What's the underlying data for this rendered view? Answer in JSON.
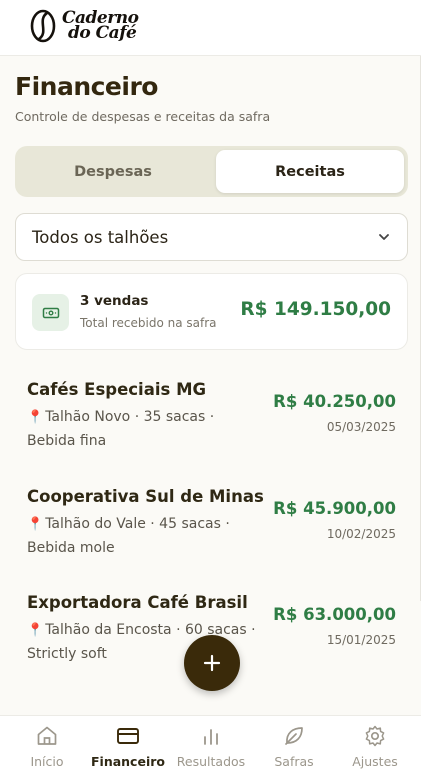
{
  "header": {
    "logo_line1": "Caderno",
    "logo_line2": "do Café"
  },
  "page": {
    "title": "Financeiro",
    "subtitle": "Controle de despesas e receitas da safra"
  },
  "tabs": [
    {
      "label": "Despesas",
      "active": false
    },
    {
      "label": "Receitas",
      "active": true
    }
  ],
  "filter": {
    "selected": "Todos os talhões"
  },
  "summary": {
    "count": "3 vendas",
    "label": "Total recebido na safra",
    "total": "R$ 149.150,00",
    "icon": "money-icon"
  },
  "sales": [
    {
      "buyer": "Cafés Especiais MG",
      "plot": "Talhão Novo · 35 sacas ·",
      "quality": "Bebida fina",
      "amount": "R$ 40.250,00",
      "date": "05/03/2025"
    },
    {
      "buyer": "Cooperativa Sul de Minas",
      "plot": "Talhão do Vale · 45 sacas ·",
      "quality": "Bebida mole",
      "amount": "R$ 45.900,00",
      "date": "10/02/2025"
    },
    {
      "buyer": "Exportadora Café Brasil",
      "plot": "Talhão da Encosta · 60 sacas ·",
      "quality": "Strictly soft",
      "amount": "R$ 63.000,00",
      "date": "15/01/2025"
    }
  ],
  "fab_icon": "plus-icon",
  "nav": [
    {
      "label": "Início",
      "icon": "home-icon",
      "active": false
    },
    {
      "label": "Financeiro",
      "icon": "wallet-icon",
      "active": true
    },
    {
      "label": "Resultados",
      "icon": "bar-chart-icon",
      "active": false
    },
    {
      "label": "Safras",
      "icon": "leaf-icon",
      "active": false
    },
    {
      "label": "Ajustes",
      "icon": "gear-icon",
      "active": false
    }
  ],
  "colors": {
    "primary": "#3a2a0a",
    "positive": "#2f7d45",
    "segment_bg": "#e8e7d8",
    "page_bg": "#fbfaf6",
    "pin": "#d0392c"
  }
}
